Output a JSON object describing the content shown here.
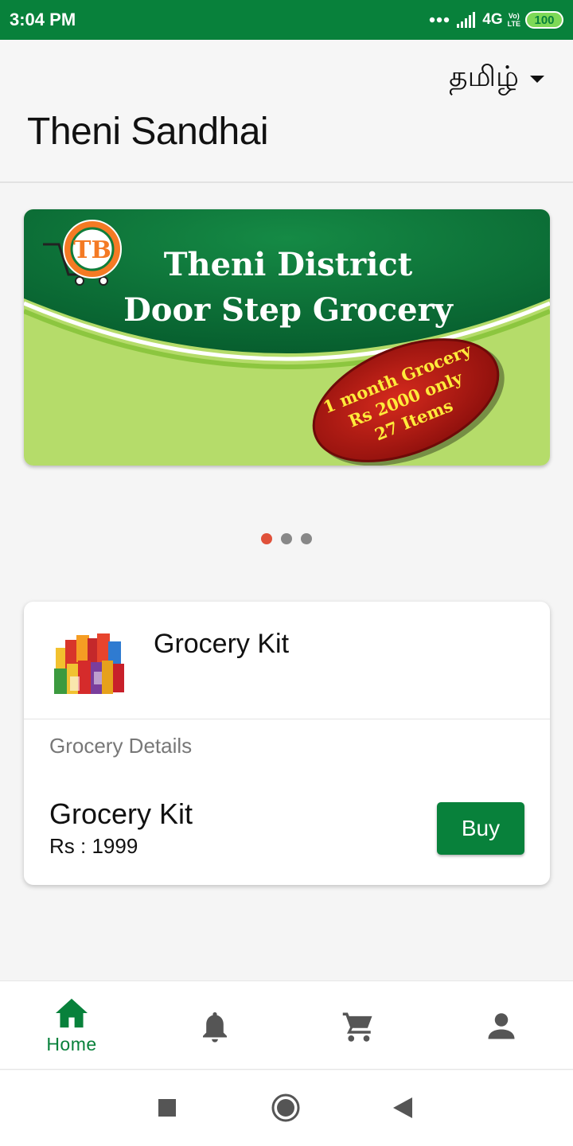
{
  "status_bar": {
    "time": "3:04 PM",
    "network": "4G",
    "volte_top": "Vo)",
    "volte_bottom": "LTE",
    "battery": "100"
  },
  "header": {
    "language": "தமிழ்",
    "title": "Theni Sandhai"
  },
  "banner": {
    "line1": "Theni District",
    "line2": "Door Step Grocery",
    "badge_line1": "1 month Grocery",
    "badge_line2": "Rs 2000 only",
    "badge_line3": "27 Items",
    "logo_letters": "TB"
  },
  "carousel": {
    "slide_count": 3,
    "active_index": 0
  },
  "product_card": {
    "title": "Grocery Kit",
    "details_label": "Grocery Details",
    "item_name": "Grocery Kit",
    "price": "Rs : 1999",
    "buy_label": "Buy"
  },
  "bottom_nav": {
    "items": [
      {
        "label": "Home",
        "icon": "home-icon",
        "active": true
      },
      {
        "label": "",
        "icon": "bell-icon",
        "active": false
      },
      {
        "label": "",
        "icon": "cart-icon",
        "active": false
      },
      {
        "label": "",
        "icon": "person-icon",
        "active": false
      }
    ]
  },
  "colors": {
    "primary": "#08813b",
    "banner_dark_green": "#0b6b36",
    "banner_light_green": "#b5dc6a",
    "badge_red": "#c01a17",
    "badge_text": "#ffeb3b",
    "dot_active": "#e0513a"
  }
}
